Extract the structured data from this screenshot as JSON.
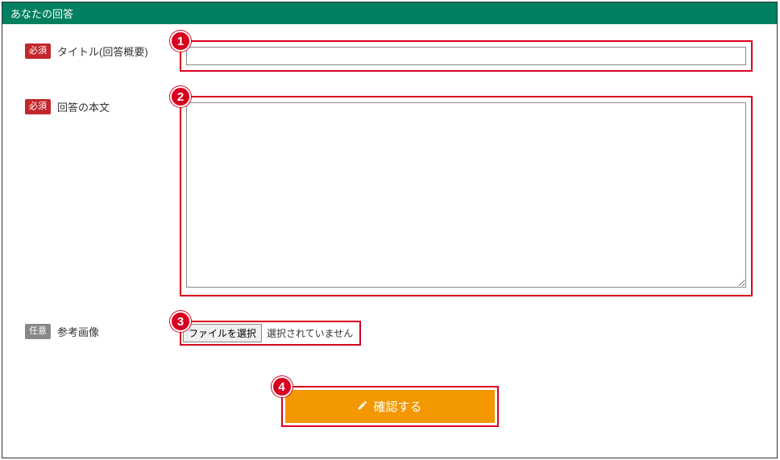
{
  "header": {
    "title": "あなたの回答"
  },
  "badges": {
    "required": "必須",
    "optional": "任意"
  },
  "fields": {
    "title": {
      "label": "タイトル(回答概要)",
      "value": "",
      "callout": "1"
    },
    "body": {
      "label": "回答の本文",
      "value": "",
      "callout": "2"
    },
    "image": {
      "label": "参考画像",
      "button": "ファイルを選択",
      "status": "選択されていません",
      "callout": "3"
    }
  },
  "submit": {
    "label": "確認する",
    "callout": "4"
  }
}
